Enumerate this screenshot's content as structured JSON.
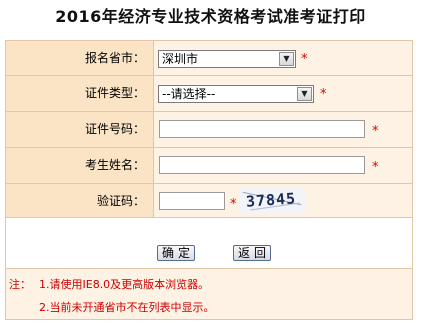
{
  "title": "2016年经济专业技术资格考试准考证打印",
  "form": {
    "province_label": "报名省市：",
    "province_value": "深圳市",
    "id_type_label": "证件类型：",
    "id_type_value": "--请选择--",
    "id_number_label": "证件号码：",
    "name_label": "考生姓名：",
    "captcha_label": "验证码：",
    "captcha_text": "37845",
    "required_mark": "*"
  },
  "buttons": {
    "confirm": "确定",
    "back": "返回"
  },
  "notes": {
    "prefix": "注：",
    "line1": "1.请使用IE8.0及更高版本浏览器。",
    "line2": "2.当前未开通省市不在列表中显示。"
  }
}
